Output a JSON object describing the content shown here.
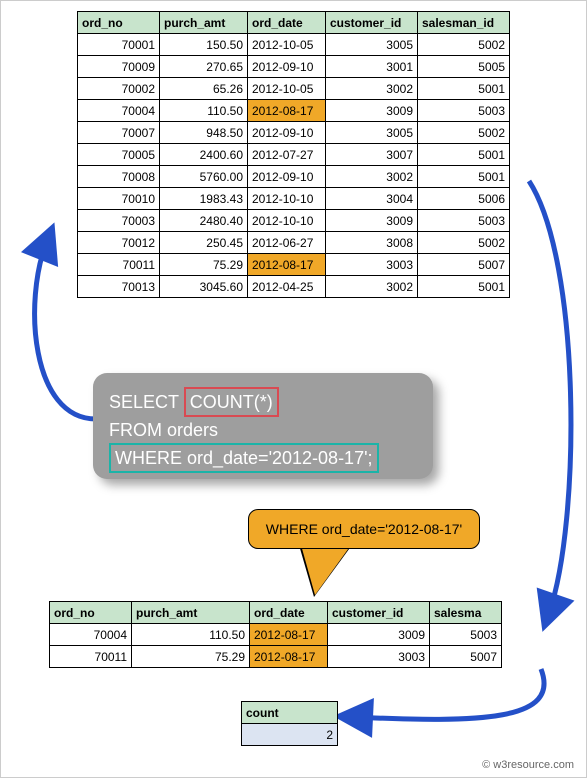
{
  "main_table": {
    "headers": [
      "ord_no",
      "purch_amt",
      "ord_date",
      "customer_id",
      "salesman_id"
    ],
    "rows": [
      {
        "ord_no": "70001",
        "purch_amt": "150.50",
        "ord_date": "2012-10-05",
        "customer_id": "3005",
        "salesman_id": "5002",
        "hl": false
      },
      {
        "ord_no": "70009",
        "purch_amt": "270.65",
        "ord_date": "2012-09-10",
        "customer_id": "3001",
        "salesman_id": "5005",
        "hl": false
      },
      {
        "ord_no": "70002",
        "purch_amt": "65.26",
        "ord_date": "2012-10-05",
        "customer_id": "3002",
        "salesman_id": "5001",
        "hl": false
      },
      {
        "ord_no": "70004",
        "purch_amt": "110.50",
        "ord_date": "2012-08-17",
        "customer_id": "3009",
        "salesman_id": "5003",
        "hl": true
      },
      {
        "ord_no": "70007",
        "purch_amt": "948.50",
        "ord_date": "2012-09-10",
        "customer_id": "3005",
        "salesman_id": "5002",
        "hl": false
      },
      {
        "ord_no": "70005",
        "purch_amt": "2400.60",
        "ord_date": "2012-07-27",
        "customer_id": "3007",
        "salesman_id": "5001",
        "hl": false
      },
      {
        "ord_no": "70008",
        "purch_amt": "5760.00",
        "ord_date": "2012-09-10",
        "customer_id": "3002",
        "salesman_id": "5001",
        "hl": false
      },
      {
        "ord_no": "70010",
        "purch_amt": "1983.43",
        "ord_date": "2012-10-10",
        "customer_id": "3004",
        "salesman_id": "5006",
        "hl": false
      },
      {
        "ord_no": "70003",
        "purch_amt": "2480.40",
        "ord_date": "2012-10-10",
        "customer_id": "3009",
        "salesman_id": "5003",
        "hl": false
      },
      {
        "ord_no": "70012",
        "purch_amt": "250.45",
        "ord_date": "2012-06-27",
        "customer_id": "3008",
        "salesman_id": "5002",
        "hl": false
      },
      {
        "ord_no": "70011",
        "purch_amt": "75.29",
        "ord_date": "2012-08-17",
        "customer_id": "3003",
        "salesman_id": "5007",
        "hl": true
      },
      {
        "ord_no": "70013",
        "purch_amt": "3045.60",
        "ord_date": "2012-04-25",
        "customer_id": "3002",
        "salesman_id": "5001",
        "hl": false
      }
    ]
  },
  "filtered_table": {
    "headers": [
      "ord_no",
      "purch_amt",
      "ord_date",
      "customer_id",
      "salesma"
    ],
    "rows": [
      {
        "ord_no": "70004",
        "purch_amt": "110.50",
        "ord_date": "2012-08-17",
        "customer_id": "3009",
        "salesman_id": "5003"
      },
      {
        "ord_no": "70011",
        "purch_amt": "75.29",
        "ord_date": "2012-08-17",
        "customer_id": "3003",
        "salesman_id": "5007"
      }
    ]
  },
  "count_table": {
    "header": "count",
    "value": "2"
  },
  "sql": {
    "select": "SELECT",
    "count": "COUNT(*)",
    "from": "FROM orders",
    "where": "WHERE ord_date='2012-08-17';"
  },
  "callout": {
    "text": "WHERE ord_date='2012-08-17'"
  },
  "attrib": "© w3resource.com",
  "colors": {
    "header_bg": "#c8e4cc",
    "highlight": "#f0a828",
    "arrow": "#2450c8"
  }
}
